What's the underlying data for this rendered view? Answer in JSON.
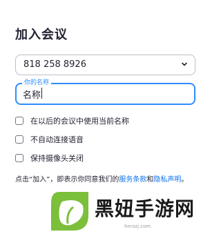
{
  "dialog": {
    "title": "加入会议",
    "meeting_id": {
      "value": "818 258 8926",
      "chevron_icon": "chevron-down-icon"
    },
    "name_field": {
      "label": "你的名称",
      "value": "名称"
    },
    "options": [
      {
        "label": "在以后的会议中使用当前名称",
        "checked": false
      },
      {
        "label": "不自动连接语音",
        "checked": false
      },
      {
        "label": "保持摄像头关闭",
        "checked": false
      }
    ],
    "terms": {
      "prefix": "点击“加入”，即表示你同意我们的",
      "link1": "服务条款",
      "middle": "和",
      "link2": "隐私声明",
      "suffix": "。"
    }
  },
  "watermark": {
    "text": "黑妞手游网",
    "url": "hnrzzj.com"
  },
  "colors": {
    "accent": "#2d8cff",
    "link": "#0e72ed",
    "text": "#232333",
    "logo_green": "#7bbf3a"
  }
}
